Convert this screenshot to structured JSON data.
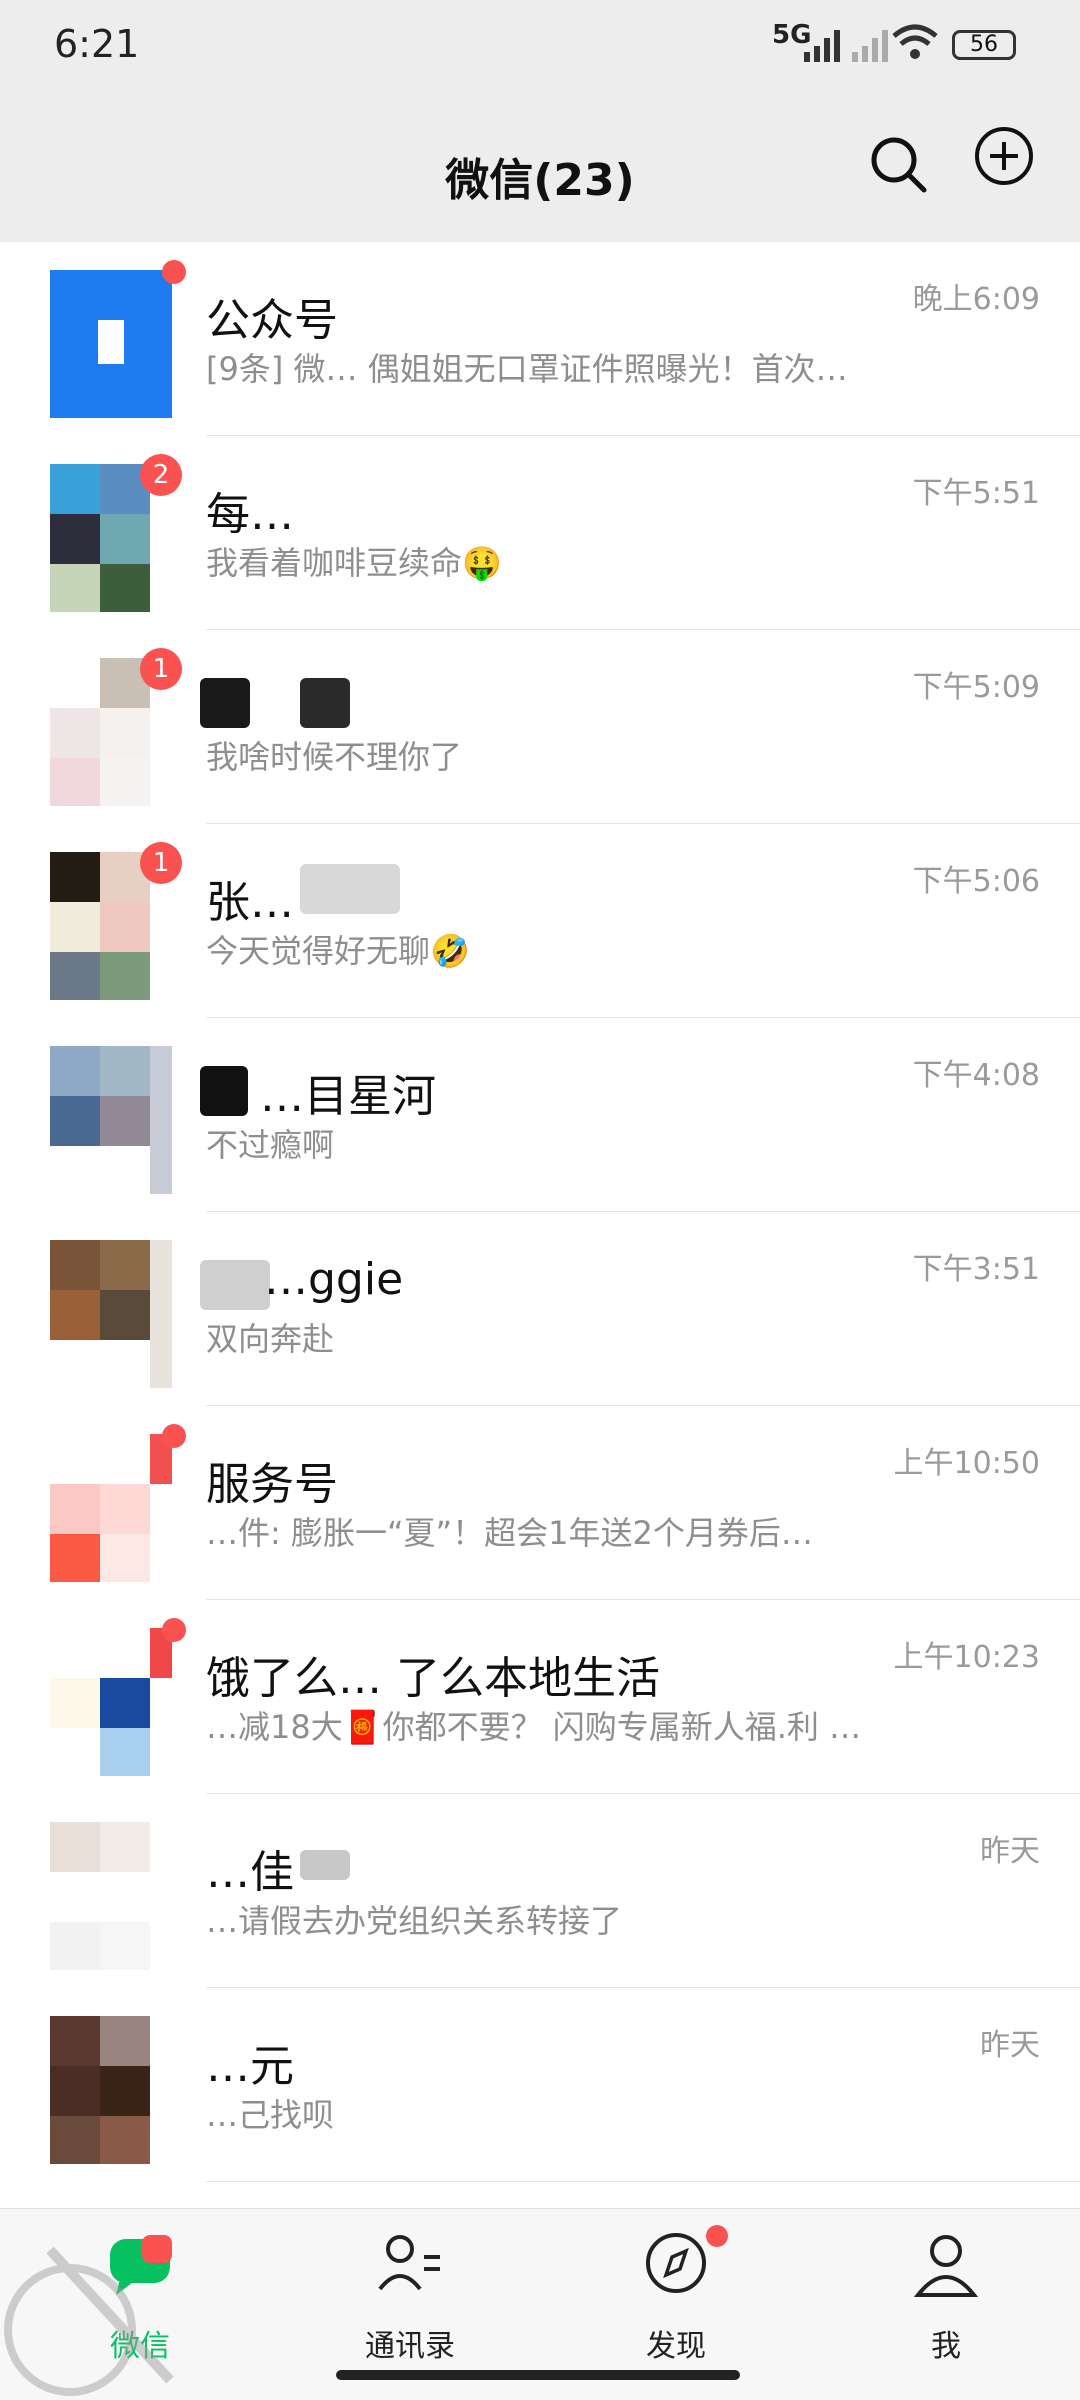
{
  "status_bar": {
    "time": "6:21",
    "network": "5G",
    "battery": "56"
  },
  "header": {
    "title": "微信(23)"
  },
  "chats": [
    {
      "name": "公众号",
      "preview": "[9条] 微… 偶姐姐无口罩证件照曝光！首次…",
      "time": "晚上6:09",
      "badge": "",
      "dot": true
    },
    {
      "name": "每…",
      "preview": "我看着咖啡豆续命🤑",
      "time": "下午5:51",
      "badge": "2",
      "dot": false
    },
    {
      "name": "",
      "preview": "我啥时候不理你了",
      "time": "下午5:09",
      "badge": "1",
      "dot": false
    },
    {
      "name": "张…",
      "preview": "今天觉得好无聊🤣",
      "time": "下午5:06",
      "badge": "1",
      "dot": false
    },
    {
      "name": "…目星河",
      "preview": "不过瘾啊",
      "time": "下午4:08",
      "badge": "",
      "dot": false
    },
    {
      "name": "…ggie",
      "preview": "双向奔赴",
      "time": "下午3:51",
      "badge": "",
      "dot": false
    },
    {
      "name": "服务号",
      "preview": "…件: 膨胀一“夏”！超会1年送2个月券后…",
      "time": "上午10:50",
      "badge": "",
      "dot": true
    },
    {
      "name": "饿了么… 了么本地生活",
      "preview": "…减18大🧧你都不要？ 闪购专属新人福.利 …",
      "time": "上午10:23",
      "badge": "",
      "dot": true
    },
    {
      "name": "…佳",
      "preview": "…请假去办党组织关系转接了",
      "time": "昨天",
      "badge": "",
      "dot": false
    },
    {
      "name": "…元",
      "preview": "…己找呗",
      "time": "昨天",
      "badge": "",
      "dot": false
    }
  ],
  "tabs": [
    {
      "label": "微信",
      "icon": "chat-icon"
    },
    {
      "label": "通讯录",
      "icon": "contacts-icon"
    },
    {
      "label": "发现",
      "icon": "compass-icon"
    },
    {
      "label": "我",
      "icon": "profile-icon"
    }
  ],
  "colors": {
    "header_bg": "#ededed",
    "badge_red": "#fa5151",
    "accent_orange": "#e58a2b"
  }
}
